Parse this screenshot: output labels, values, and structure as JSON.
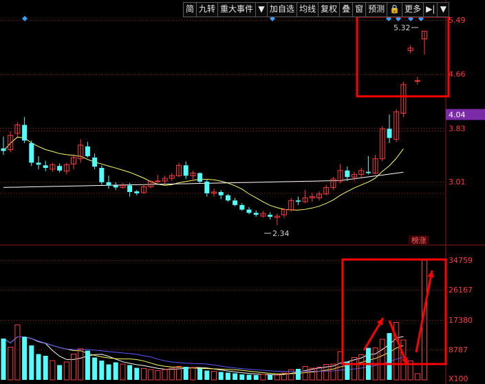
{
  "toolbar": {
    "items": [
      {
        "label": "简",
        "name": "toolbar-jian"
      },
      {
        "label": "九转",
        "name": "toolbar-jiuzhuan"
      },
      {
        "label": "重大事件",
        "name": "toolbar-major-events"
      },
      {
        "label": "▼",
        "name": "toolbar-dropdown-1"
      },
      {
        "label": "加自选",
        "name": "toolbar-add-watchlist"
      },
      {
        "label": "均线",
        "name": "toolbar-moving-average"
      },
      {
        "label": "复权",
        "name": "toolbar-restore-rights"
      },
      {
        "label": "叠",
        "name": "toolbar-overlay"
      },
      {
        "label": "窗",
        "name": "toolbar-window"
      },
      {
        "label": "预测",
        "name": "toolbar-forecast"
      },
      {
        "label": "🔒",
        "name": "toolbar-lock"
      },
      {
        "label": "更多",
        "name": "toolbar-more"
      },
      {
        "label": "▶|",
        "name": "toolbar-jump"
      },
      {
        "label": "▼",
        "name": "toolbar-dropdown-2"
      }
    ]
  },
  "price_axis": [
    {
      "label": "5.49",
      "value": 5.49
    },
    {
      "label": "4.66",
      "value": 4.66
    },
    {
      "label": "3.83",
      "value": 3.83
    },
    {
      "label": "3.01",
      "value": 3.01
    }
  ],
  "current_price_label": "4.04",
  "current_price": 4.04,
  "annotations": {
    "high_label": "5.32",
    "low_label": "2.34",
    "tag_label": "榜涨"
  },
  "volume_axis": [
    {
      "label": "34759",
      "value": 34759
    },
    {
      "label": "26167",
      "value": 26167
    },
    {
      "label": "17380",
      "value": 17380
    },
    {
      "label": "8787",
      "value": 8787
    }
  ],
  "volume_unit_label": "X100",
  "colors": {
    "up": "#ff3c3c",
    "down": "#54fcfc",
    "ma_short": "#ffff66",
    "ma_long": "#ffffff",
    "vol_ma_blue": "#5a5aff",
    "grid": "#8a1c1c",
    "highlight": "#ff0000",
    "price_tag_bg": "#7b2aa8"
  },
  "chart_data": {
    "type": "candlestick",
    "price_range": [
      2.1,
      5.65
    ],
    "volume_range": [
      0,
      36000
    ],
    "candles": [
      [
        3.52,
        3.7,
        3.42,
        3.48
      ],
      [
        3.5,
        3.78,
        3.46,
        3.72
      ],
      [
        3.75,
        3.92,
        3.7,
        3.88
      ],
      [
        3.88,
        4.0,
        3.6,
        3.64
      ],
      [
        3.6,
        3.64,
        3.25,
        3.3
      ],
      [
        3.3,
        3.4,
        3.2,
        3.27
      ],
      [
        3.26,
        3.33,
        3.17,
        3.22
      ],
      [
        3.2,
        3.3,
        3.16,
        3.27
      ],
      [
        3.25,
        3.29,
        3.15,
        3.18
      ],
      [
        3.17,
        3.3,
        3.12,
        3.27
      ],
      [
        3.28,
        3.43,
        3.2,
        3.38
      ],
      [
        3.36,
        3.66,
        3.3,
        3.57
      ],
      [
        3.55,
        3.62,
        3.38,
        3.4
      ],
      [
        3.38,
        3.44,
        3.2,
        3.24
      ],
      [
        3.22,
        3.26,
        2.96,
        3.0
      ],
      [
        3.0,
        3.1,
        2.9,
        2.95
      ],
      [
        2.95,
        3.0,
        2.88,
        2.92
      ],
      [
        2.92,
        2.99,
        2.9,
        2.95
      ],
      [
        2.95,
        2.99,
        2.78,
        2.85
      ],
      [
        2.86,
        2.88,
        2.8,
        2.83
      ],
      [
        2.84,
        2.97,
        2.82,
        2.93
      ],
      [
        2.93,
        3.03,
        2.91,
        3.01
      ],
      [
        3.01,
        3.11,
        2.99,
        3.02
      ],
      [
        3.02,
        3.1,
        2.98,
        3.06
      ],
      [
        3.06,
        3.14,
        3.02,
        3.1
      ],
      [
        3.1,
        3.3,
        3.08,
        3.26
      ],
      [
        3.26,
        3.32,
        3.05,
        3.1
      ],
      [
        3.1,
        3.18,
        3.02,
        3.14
      ],
      [
        3.14,
        3.15,
        2.98,
        3.01
      ],
      [
        3.01,
        3.04,
        2.78,
        2.83
      ],
      [
        2.83,
        2.9,
        2.78,
        2.85
      ],
      [
        2.85,
        2.88,
        2.74,
        2.8
      ],
      [
        2.8,
        2.82,
        2.7,
        2.72
      ],
      [
        2.72,
        2.76,
        2.63,
        2.65
      ],
      [
        2.65,
        2.68,
        2.56,
        2.58
      ],
      [
        2.58,
        2.62,
        2.51,
        2.53
      ],
      [
        2.53,
        2.57,
        2.47,
        2.5
      ],
      [
        2.48,
        2.56,
        2.46,
        2.52
      ],
      [
        2.5,
        2.54,
        2.43,
        2.47
      ],
      [
        2.46,
        2.52,
        2.34,
        2.48
      ],
      [
        2.5,
        2.6,
        2.45,
        2.58
      ],
      [
        2.58,
        2.76,
        2.55,
        2.72
      ],
      [
        2.72,
        2.78,
        2.65,
        2.7
      ],
      [
        2.7,
        2.88,
        2.68,
        2.76
      ],
      [
        2.76,
        2.84,
        2.7,
        2.78
      ],
      [
        2.76,
        2.86,
        2.72,
        2.82
      ],
      [
        2.82,
        2.96,
        2.8,
        2.92
      ],
      [
        2.92,
        3.08,
        2.88,
        3.05
      ],
      [
        3.02,
        3.28,
        2.98,
        3.18
      ],
      [
        3.18,
        3.24,
        3.02,
        3.08
      ],
      [
        3.08,
        3.16,
        3.02,
        3.12
      ],
      [
        3.12,
        3.22,
        3.08,
        3.18
      ],
      [
        3.16,
        3.4,
        3.12,
        3.14
      ],
      [
        3.14,
        3.42,
        3.12,
        3.36
      ],
      [
        3.36,
        3.86,
        3.32,
        3.82
      ],
      [
        3.82,
        4.04,
        3.6,
        3.68
      ],
      [
        3.66,
        4.12,
        3.62,
        4.08
      ],
      [
        4.06,
        4.54,
        4.0,
        4.5
      ],
      [
        5.02,
        5.1,
        4.98,
        5.06
      ],
      [
        4.56,
        4.62,
        4.5,
        4.56
      ],
      [
        5.2,
        5.32,
        4.96,
        5.32
      ]
    ],
    "volumes": [
      12000,
      9500,
      16000,
      12500,
      10000,
      7500,
      7000,
      5600,
      4300,
      5200,
      7500,
      9000,
      8500,
      6500,
      5600,
      4500,
      5100,
      4600,
      4300,
      3500,
      3300,
      3000,
      2700,
      3000,
      3400,
      3900,
      3800,
      3600,
      3300,
      2700,
      2500,
      2300,
      2100,
      1900,
      1600,
      1500,
      1400,
      1600,
      1500,
      1400,
      2000,
      3000,
      3200,
      3900,
      3400,
      3700,
      4500,
      4600,
      8200,
      5300,
      6500,
      7300,
      9300,
      9300,
      11800,
      13600,
      16700,
      11600,
      5500,
      1800,
      34759
    ],
    "ma_short_params": 10,
    "ma_long_params": 60
  }
}
